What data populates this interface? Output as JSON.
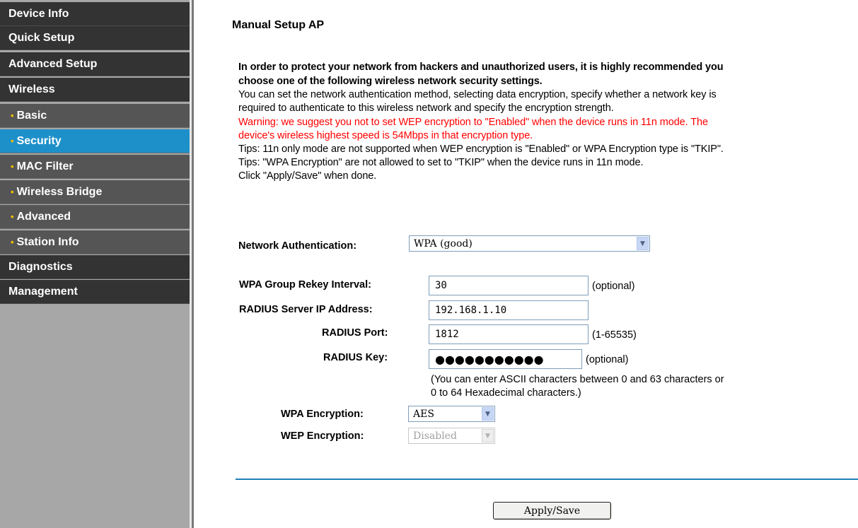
{
  "sidebar": {
    "items": [
      {
        "label": "Device Info"
      },
      {
        "label": "Quick Setup"
      },
      {
        "label": "Advanced Setup"
      },
      {
        "label": "Wireless"
      },
      {
        "label": "Basic"
      },
      {
        "label": "Security"
      },
      {
        "label": "MAC Filter"
      },
      {
        "label": "Wireless Bridge"
      },
      {
        "label": "Advanced"
      },
      {
        "label": "Station Info"
      },
      {
        "label": "Diagnostics"
      },
      {
        "label": "Management"
      }
    ],
    "active_item": "Security",
    "bullet": "•"
  },
  "main": {
    "title": "Manual Setup AP",
    "description": {
      "line1": "In order to protect your network from hackers and unauthorized users, it is highly recommended you",
      "line2": "choose one of the following wireless network security settings.",
      "line3": "You can set the network authentication method, selecting data encryption, specify whether a network key is",
      "line4": "required to authenticate to this wireless network and specify the encryption strength.",
      "warning1": "Warning: we suggest you not to set WEP encryption to \"Enabled\" when the device runs in 11n mode. The",
      "warning2": "device's wireless highest speed is 54Mbps in that encryption type.",
      "tip1": "Tips: 11n only mode are not supported when WEP encryption is \"Enabled\" or WPA Encryption type is \"TKIP\".",
      "tip2": "Tips: \"WPA Encryption\" are not allowed to set to \"TKIP\" when the device runs in 11n mode.",
      "click_note": "Click \"Apply/Save\" when done."
    },
    "form": {
      "network_auth": {
        "label": "Network Authentication:",
        "value": "WPA (good)"
      },
      "rekey_interval": {
        "label": "WPA Group Rekey Interval:",
        "value": "30",
        "hint": "(optional)"
      },
      "radius_ip": {
        "label": "RADIUS Server IP Address:",
        "value": "192.168.1.10"
      },
      "radius_port": {
        "label": "RADIUS Port:",
        "value": "1812",
        "hint": "(1-65535)"
      },
      "radius_key": {
        "label": "RADIUS Key:",
        "value": "●●●●●●●●●●●",
        "hint": "(optional)",
        "note1": "(You can enter ASCII characters between 0 and 63 characters or",
        "note2": "0 to 64 Hexadecimal characters.)"
      },
      "wpa_encryption": {
        "label": "WPA Encryption:",
        "value": "AES"
      },
      "wep_encryption": {
        "label": "WEP Encryption:",
        "value": "Disabled",
        "disabled": true
      }
    },
    "apply_button": "Apply/Save"
  },
  "colors": {
    "sidebar_bg": "#a7a7a7",
    "nav_main_bg": "#333333",
    "nav_sub_bg": "#555555",
    "active_bg": "#1e90c9",
    "bullet": "#f2c100",
    "warning_text": "#ff0000",
    "divider": "#1e7fb8"
  }
}
